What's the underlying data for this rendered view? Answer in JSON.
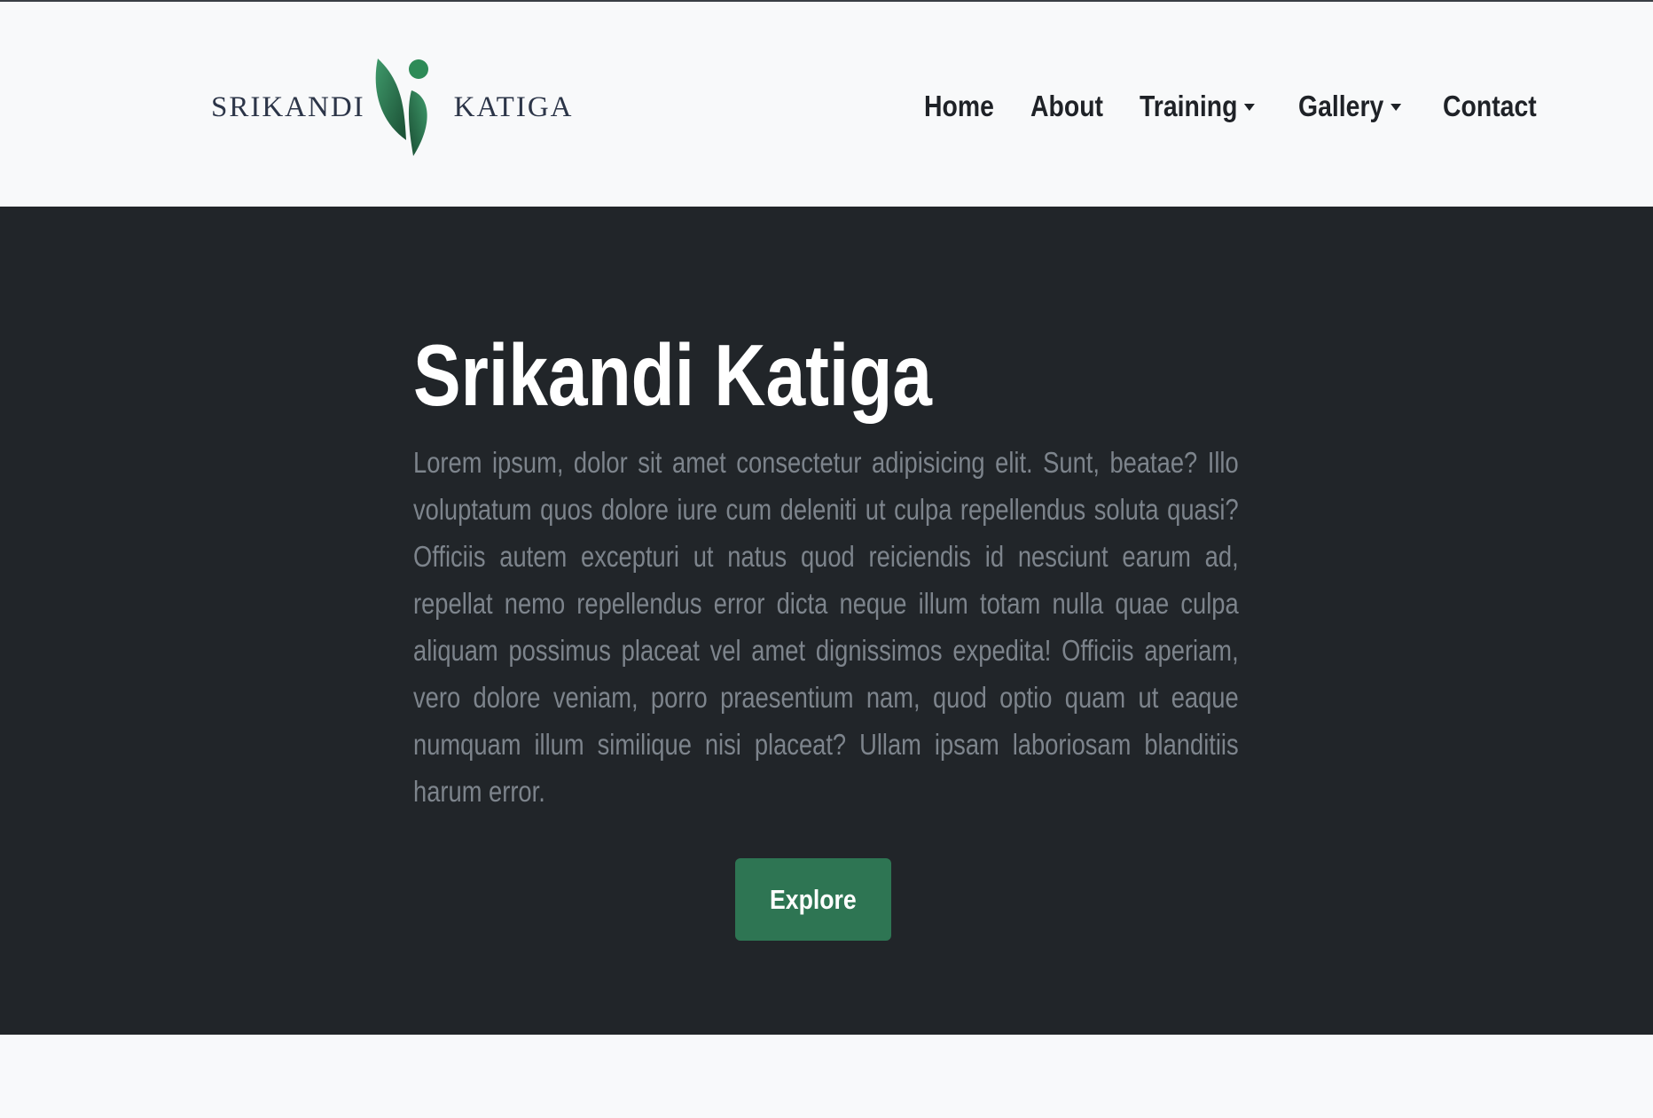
{
  "brand": {
    "left_word": "SRIKANDI",
    "right_word": "KATIGA",
    "mark_icon": "figure-leaf-logo-icon",
    "colors": {
      "text": "#2c3548",
      "leaf_dark": "#1f5c3c",
      "leaf_light": "#2e8b57"
    }
  },
  "nav": {
    "items": [
      {
        "label": "Home",
        "has_dropdown": false
      },
      {
        "label": "About",
        "has_dropdown": false
      },
      {
        "label": "Training",
        "has_dropdown": true
      },
      {
        "label": "Gallery",
        "has_dropdown": true
      },
      {
        "label": "Contact",
        "has_dropdown": false
      }
    ]
  },
  "hero": {
    "title": "Srikandi Katiga",
    "text": "Lorem ipsum, dolor sit amet consectetur adipisicing elit. Sunt, beatae? Illo voluptatum quos dolore iure cum deleniti ut culpa repellendus soluta quasi? Officiis autem excepturi ut natus quod reiciendis id nesciunt earum ad, repellat nemo repellendus error dicta neque illum totam nulla quae culpa aliquam possimus placeat vel amet dignissimos expedita! Officiis aperiam, vero dolore veniam, porro praesentium nam, quod optio quam ut eaque numquam illum similique nisi placeat? Ullam ipsam laboriosam blanditiis harum error.",
    "button_label": "Explore",
    "colors": {
      "background": "#212529",
      "button": "#2e7553",
      "text": "#7d848c"
    }
  }
}
